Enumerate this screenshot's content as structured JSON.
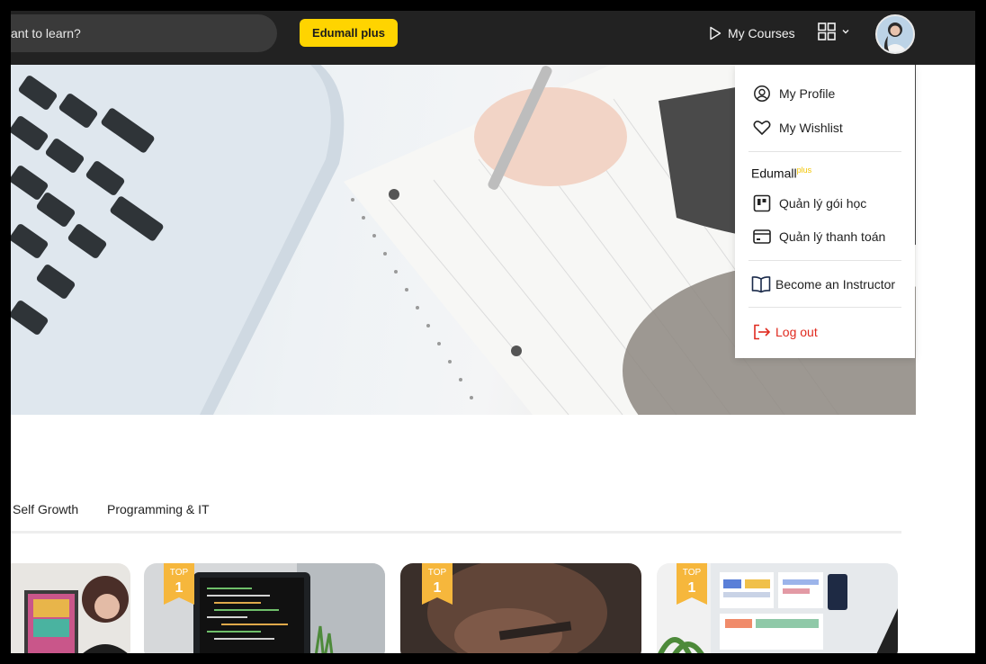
{
  "header": {
    "search_placeholder": "ant to learn?",
    "plus_button": "Edumall plus",
    "my_courses": "My Courses"
  },
  "menu": {
    "my_profile": "My Profile",
    "my_wishlist": "My Wishlist",
    "edumall_brand": "Edumall",
    "edumall_sup": "plus",
    "manage_courses": "Quản lý gói học",
    "manage_payments": "Quản lý thanh toán",
    "become_instructor": "Become an Instructor",
    "logout": "Log out"
  },
  "tabs": [
    {
      "label": "Self Growth"
    },
    {
      "label": "Programming & IT"
    }
  ],
  "cards": [
    {
      "badge": ""
    },
    {
      "badge": "TOP",
      "rank": "1"
    },
    {
      "badge": "TOP",
      "rank": "1"
    },
    {
      "badge": "TOP",
      "rank": "1"
    }
  ],
  "colors": {
    "topbar": "#222222",
    "accent_yellow": "#ffd400",
    "logout_red": "#e02a1f",
    "badge_orange": "#f6b73c"
  }
}
